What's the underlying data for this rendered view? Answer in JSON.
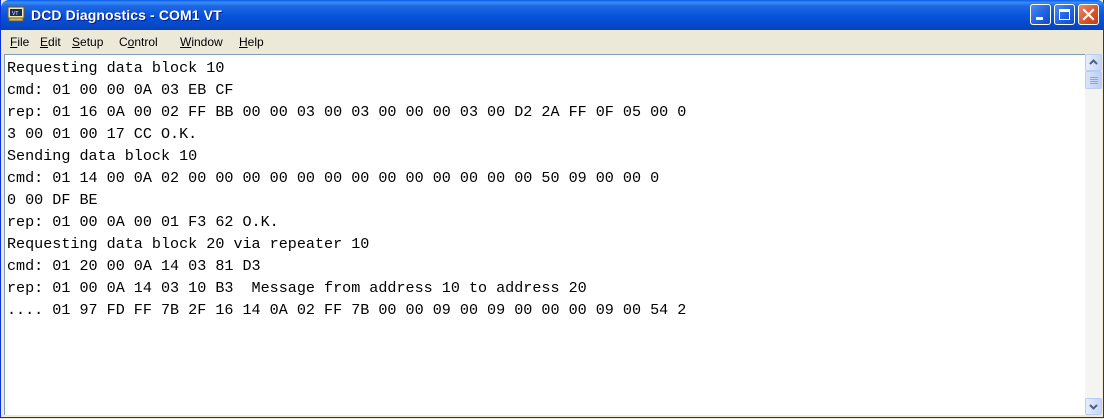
{
  "window": {
    "title": "DCD Diagnostics - COM1 VT",
    "icon": "terminal-app-icon",
    "controls": [
      "minimize-icon",
      "maximize-icon",
      "close-icon"
    ]
  },
  "menu": [
    {
      "key": "F",
      "rest": "ile"
    },
    {
      "key": "E",
      "rest": "dit"
    },
    {
      "key": "S",
      "rest": "etup"
    },
    {
      "pre": "C",
      "key": "o",
      "rest": "ntrol"
    },
    {
      "key": "W",
      "rest": "indow"
    },
    {
      "key": "H",
      "rest": "elp"
    }
  ],
  "terminal": {
    "lines": [
      "Requesting data block 10",
      "cmd: 01 00 00 0A 03 EB CF",
      "rep: 01 16 0A 00 02 FF BB 00 00 03 00 03 00 00 00 03 00 D2 2A FF 0F 05 00 0",
      "3 00 01 00 17 CC O.K.",
      "Sending data block 10",
      "cmd: 01 14 00 0A 02 00 00 00 00 00 00 00 00 00 00 00 00 00 50 09 00 00 0",
      "0 00 DF BE",
      "rep: 01 00 0A 00 01 F3 62 O.K.",
      "Requesting data block 20 via repeater 10",
      "cmd: 01 20 00 0A 14 03 81 D3",
      "rep: 01 00 0A 14 03 10 B3  Message from address 10 to address 20",
      ".... 01 97 FD FF 7B 2F 16 14 0A 02 FF 7B 00 00 09 00 09 00 00 00 09 00 54 2"
    ]
  },
  "scrollbar": {
    "up": "scroll-up-arrow-icon",
    "down": "scroll-down-arrow-icon"
  }
}
